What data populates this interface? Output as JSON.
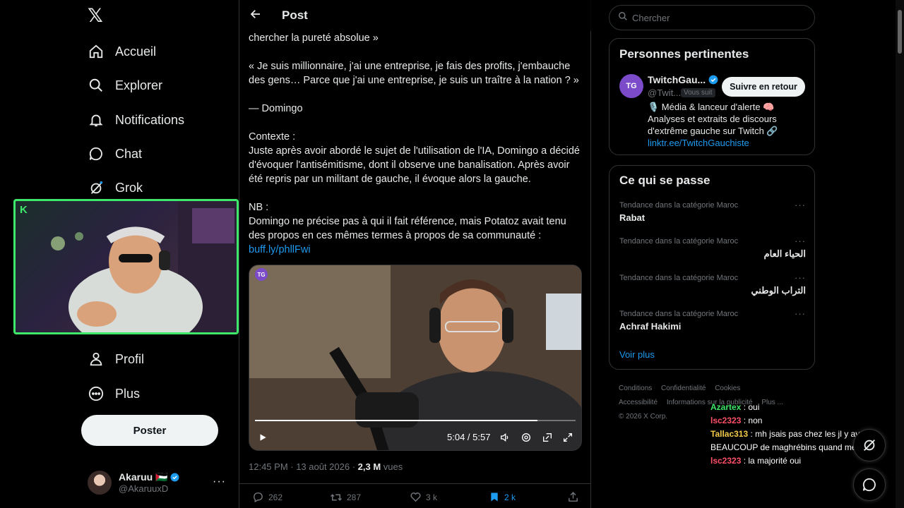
{
  "nav": {
    "items": [
      {
        "label": "Accueil",
        "icon": "home-icon"
      },
      {
        "label": "Explorer",
        "icon": "search-icon"
      },
      {
        "label": "Notifications",
        "icon": "bell-icon"
      },
      {
        "label": "Chat",
        "icon": "chat-icon"
      },
      {
        "label": "Grok",
        "icon": "grok-icon"
      },
      {
        "label": "Profil",
        "icon": "person-icon"
      },
      {
        "label": "Plus",
        "icon": "more-circle-icon"
      }
    ],
    "post_button": "Poster",
    "account": {
      "name": "Akaruu 🇵🇸",
      "handle": "@AkaruuxD"
    }
  },
  "webcam": {
    "badge": "K"
  },
  "post": {
    "header_title": "Post",
    "paragraphs": [
      "chercher la pureté absolue »",
      "« Je suis millionnaire, j'ai une entreprise, je fais des profits, j'embauche des gens… Parce que j'ai une entreprise, je suis un traître à la nation ? »",
      "— Domingo",
      "Contexte :",
      "Juste après avoir abordé le sujet de l'utilisation de l'IA, Domingo a décidé d'évoquer l'antisémitisme, dont il observe une banalisation. Après avoir été repris par un militant de gauche, il évoque alors la gauche.",
      "NB :",
      "Domingo ne précise pas à qui il fait référence, mais Potatoz avait tenu des propos en ces mêmes termes à propos de sa communauté :"
    ],
    "link": "buff.ly/phllFwi",
    "video": {
      "badge": "TG",
      "time": "5:04 / 5:57",
      "progress": 0.88
    },
    "meta": {
      "time": "12:45 PM · 13 août 2026 · ",
      "views_count": "2,3 M",
      "views_label": " vues"
    },
    "actions": {
      "replies": "262",
      "reposts": "287",
      "likes": "3 k",
      "bookmarks": "2 k"
    }
  },
  "sidebar": {
    "search_placeholder": "Chercher",
    "relevant": {
      "title": "Personnes pertinentes",
      "name": "TwitchGau...",
      "handle": "@Twit...",
      "follows_you": "Vous suit",
      "follow_button": "Suivre en retour",
      "avatar_text": "TG",
      "bio": "🎙️ Média & lanceur d'alerte 🧠 Analyses et extraits de discours d'extrême gauche sur Twitch 🔗",
      "bio_link": "linktr.ee/TwitchGauchiste"
    },
    "trends": {
      "title": "Ce qui se passe",
      "items": [
        {
          "category": "Tendance dans la catégorie Maroc",
          "name": "Rabat"
        },
        {
          "category": "Tendance dans la catégorie Maroc",
          "name": "الحياء العام"
        },
        {
          "category": "Tendance dans la catégorie Maroc",
          "name": "التراب الوطني"
        },
        {
          "category": "Tendance dans la catégorie Maroc",
          "name": "Achraf Hakimi"
        }
      ],
      "more": "Voir plus"
    },
    "footer": [
      "Conditions",
      "Confidentialité",
      "Cookies",
      "Accessibilité",
      "Informations sur la publicité",
      "Plus ...",
      "© 2026 X Corp."
    ]
  },
  "chat": [
    {
      "user": "Azartex",
      "msg": " : oui"
    },
    {
      "user": "lsc2323",
      "msg": " : non"
    },
    {
      "user": "Tallac313",
      "msg": " : mh jsais pas chez les jl y avait BEAUCOUP de maghrébins quand meme"
    },
    {
      "user": "lsc2323",
      "msg": " : la majorité oui"
    }
  ]
}
